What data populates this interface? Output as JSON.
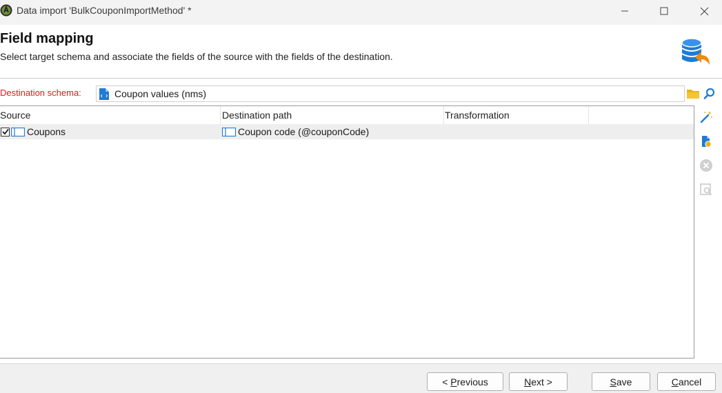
{
  "window": {
    "title": "Data import 'BulkCouponImportMethod' *",
    "app_icon": "adobe-campaign-icon",
    "controls": [
      "minimize-icon",
      "maximize-icon",
      "close-icon"
    ]
  },
  "header": {
    "title": "Field mapping",
    "subtitle": "Select target schema and associate the fields of the source with the fields of the destination.",
    "icon": "database-import-icon"
  },
  "schema": {
    "label": "Destination schema:",
    "value": "Coupon values (nms)",
    "label_color": "#d42020"
  },
  "grid": {
    "columns": [
      "Source",
      "Destination path",
      "Transformation",
      ""
    ],
    "rows": [
      {
        "checked": true,
        "source": "Coupons",
        "destination": "Coupon code (@couponCode)",
        "transformation": ""
      }
    ]
  },
  "side_toolbar": [
    "magic-wand-icon",
    "add-mapping-icon",
    "delete-icon",
    "preview-icon"
  ],
  "footer": {
    "previous": {
      "prefix": "< ",
      "accel": "P",
      "rest": "revious"
    },
    "next": {
      "accel": "N",
      "rest": "ext >"
    },
    "save": {
      "accel": "S",
      "rest": "ave"
    },
    "cancel": {
      "accel": "C",
      "rest": "ancel"
    }
  },
  "colors": {
    "accent_blue": "#1e7bd6",
    "folder_yellow": "#e8b517",
    "row_selected": "#eeeeee"
  }
}
